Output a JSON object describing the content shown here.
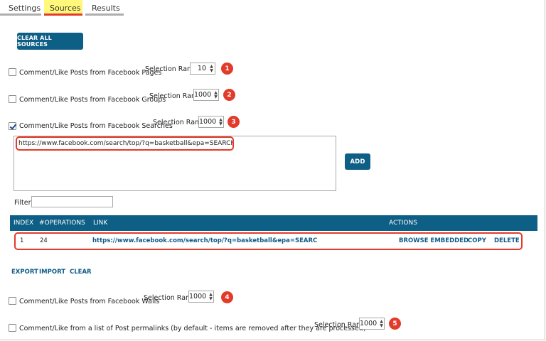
{
  "tabs": [
    {
      "label": "Settings"
    },
    {
      "label": "Sources"
    },
    {
      "label": "Results"
    }
  ],
  "active_tab": "Sources",
  "clear_all_label": "CLEAR ALL SOURCES",
  "sources": [
    {
      "label": "Comment/Like Posts from Facebook Pages",
      "checked": false,
      "rank_label": "Selection Rank",
      "rank": "10",
      "badge": "1"
    },
    {
      "label": "Comment/Like Posts from Facebook Groups",
      "checked": false,
      "rank_label": "Selection Rank",
      "rank": "1000",
      "badge": "2"
    },
    {
      "label": "Comment/Like Posts from Facebook Searches",
      "checked": true,
      "rank_label": "Selection Rank",
      "rank": "1000",
      "badge": "3"
    },
    {
      "label": "Comment/Like Posts from Facebook Walls",
      "checked": false,
      "rank_label": "Selection Rank",
      "rank": "1000",
      "badge": "4"
    },
    {
      "label": "Comment/Like from a list of Post permalinks (by default - items are removed after they are processed)",
      "checked": false,
      "rank_label": "Selection Rank",
      "rank": "1000",
      "badge": "5"
    }
  ],
  "search_input": {
    "value": "https://www.facebook.com/search/top/?q=basketball&epa=SEARCH_BOX"
  },
  "add_label": "ADD",
  "filter": {
    "label": "Filter:",
    "value": ""
  },
  "table": {
    "headers": [
      "INDEX",
      "#OPERATIONS",
      "LINK",
      "ACTIONS"
    ],
    "rows": [
      {
        "index": "1",
        "operations": "24",
        "link": "https://www.facebook.com/search/top/?q=basketball&epa=SEARC",
        "actions": [
          "BROWSE EMBEDDED",
          "COPY",
          "DELETE"
        ]
      }
    ]
  },
  "tools": [
    "EXPORT",
    "IMPORT",
    "CLEAR"
  ],
  "colors": {
    "accent": "#0e5f86",
    "badge": "#e23b2a",
    "active_tab_bg": "#fff87a"
  },
  "icons": {
    "spinner": "up-down-arrows-icon",
    "checkbox": "checkmark-icon"
  }
}
